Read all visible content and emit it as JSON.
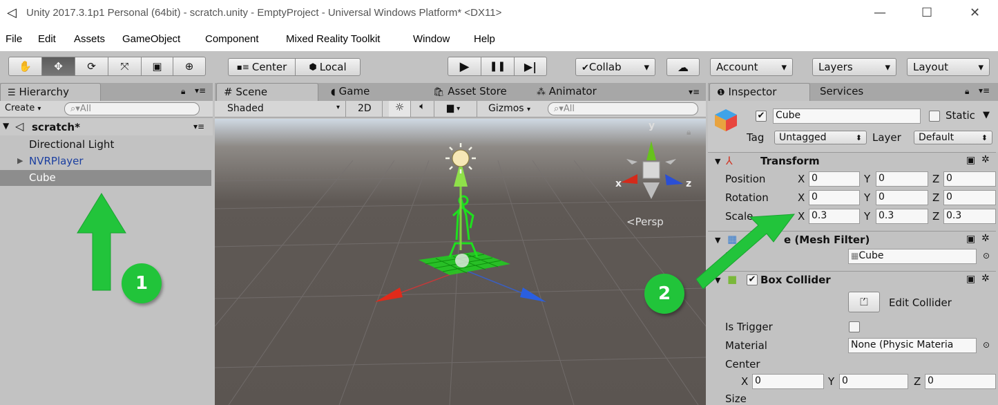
{
  "window": {
    "title": "Unity 2017.3.1p1 Personal (64bit) - scratch.unity - EmptyProject - Universal Windows Platform* <DX11>",
    "minimize": "—",
    "maximize": "☐",
    "close": "✕"
  },
  "menu": [
    "File",
    "Edit",
    "Assets",
    "GameObject",
    "Component",
    "Mixed Reality Toolkit",
    "Window",
    "Help"
  ],
  "toolbar": {
    "tools": [
      "hand-tool",
      "move-tool",
      "rotate-tool",
      "scale-tool",
      "rect-tool",
      "transform-tool"
    ],
    "tool_glyphs": [
      "✋",
      "✥",
      "⟳",
      "⤧",
      "▣",
      "⊕"
    ],
    "active_tool": "move-tool",
    "pivot_label": "Center",
    "space_label": "Local",
    "play_glyph": "▶",
    "pause_glyph": "❚❚",
    "step_glyph": "▶|",
    "collab_label": "Collab",
    "account_label": "Account",
    "layers_label": "Layers",
    "layout_label": "Layout",
    "dropdown_arrow": "▾"
  },
  "hierarchy": {
    "tab_label": "Hierarchy",
    "create_label": "Create",
    "search_placeholder": "All",
    "scene_name": "scratch*",
    "items": [
      {
        "label": "Directional Light",
        "color": "#111111",
        "expandable": false,
        "selected": false
      },
      {
        "label": "NVRPlayer",
        "color": "#1b3fa0",
        "expandable": true,
        "selected": false
      },
      {
        "label": "Cube",
        "color": "#111111",
        "expandable": false,
        "selected": true
      }
    ]
  },
  "scene": {
    "tabs": [
      "Scene",
      "Game",
      "Asset Store",
      "Animator"
    ],
    "shading_label": "Shaded",
    "mode_2d": "2D",
    "gizmos_label": "Gizmos",
    "search_placeholder": "All",
    "persp_label": "Persp",
    "axis_labels": {
      "x": "x",
      "y": "y",
      "z": "z"
    }
  },
  "inspector": {
    "tabs": [
      "Inspector",
      "Services"
    ],
    "object_name": "Cube",
    "object_active": true,
    "static_label": "Static",
    "tag_label": "Tag",
    "tag_value": "Untagged",
    "layer_label": "Layer",
    "layer_value": "Default",
    "transform": {
      "header": "Transform",
      "rows": [
        {
          "label": "Position",
          "x": "0",
          "y": "0",
          "z": "0"
        },
        {
          "label": "Rotation",
          "x": "0",
          "y": "0",
          "z": "0"
        },
        {
          "label": "Scale",
          "x": "0.3",
          "y": "0.3",
          "z": "0.3"
        }
      ],
      "axis_x": "X",
      "axis_y": "Y",
      "axis_z": "Z"
    },
    "mesh_filter": {
      "header_visible": "e (Mesh Filter)",
      "mesh_label_visible": "M",
      "mesh_value": "Cube"
    },
    "box_collider": {
      "header": "Box Collider",
      "enabled": true,
      "edit_label": "Edit Collider",
      "is_trigger_label": "Is Trigger",
      "material_label": "Material",
      "material_value": "None (Physic Materia",
      "center_label": "Center",
      "center": {
        "x": "0",
        "y": "0",
        "z": "0"
      },
      "size_label": "Size"
    }
  },
  "annotations": {
    "badge_1": "1",
    "badge_2": "2",
    "arrow_color": "#22c43b"
  }
}
